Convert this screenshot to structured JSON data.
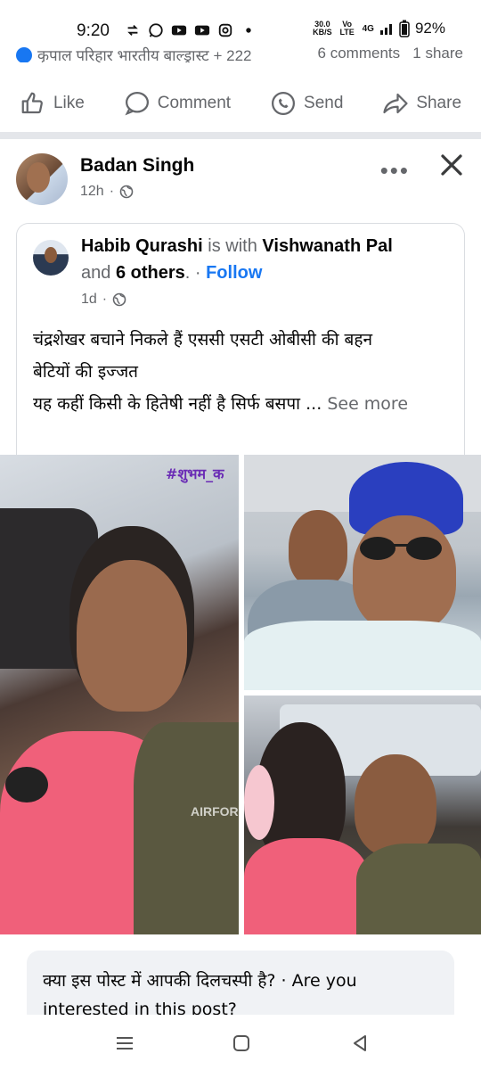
{
  "status_bar": {
    "time": "9:20",
    "network_speed_value": "30.0",
    "network_speed_unit": "KB/S",
    "volte": "Vo LTE",
    "network": "4G",
    "battery": "92%"
  },
  "previous_post": {
    "reactions_text": "कृपाल परिहार भारतीय बाल्ड्रास्ट + 222",
    "comments": "6 comments",
    "shares": "1 share",
    "actions": {
      "like": "Like",
      "comment": "Comment",
      "send": "Send",
      "share": "Share"
    }
  },
  "post": {
    "author": "Badan Singh",
    "time": "12h",
    "more_icon": "ellipsis-icon",
    "close_icon": "close-icon"
  },
  "shared": {
    "author": "Habib Qurashi",
    "with_text": "is with",
    "with_name": "Vishwanath Pal",
    "and_text": "and",
    "others": "6 others",
    "dot": ".",
    "sep": " · ",
    "follow": "Follow",
    "time": "1d",
    "text_line1": "चंद्रशेखर बचाने निकले हैं एससी एसटी ओबीसी की बहन",
    "text_line2": "बेटियों की इज्जत",
    "text_line3": "यह कहीं किसी के हितेषी नहीं है सिर्फ बसपा ...",
    "see_more": "See more",
    "photo_tag": "#शुभम_क",
    "shirt_text": "AIRFORCE"
  },
  "interest": {
    "text": "क्या इस पोस्ट में आपकी दिलचस्पी है? · Are you interested in this post?"
  }
}
